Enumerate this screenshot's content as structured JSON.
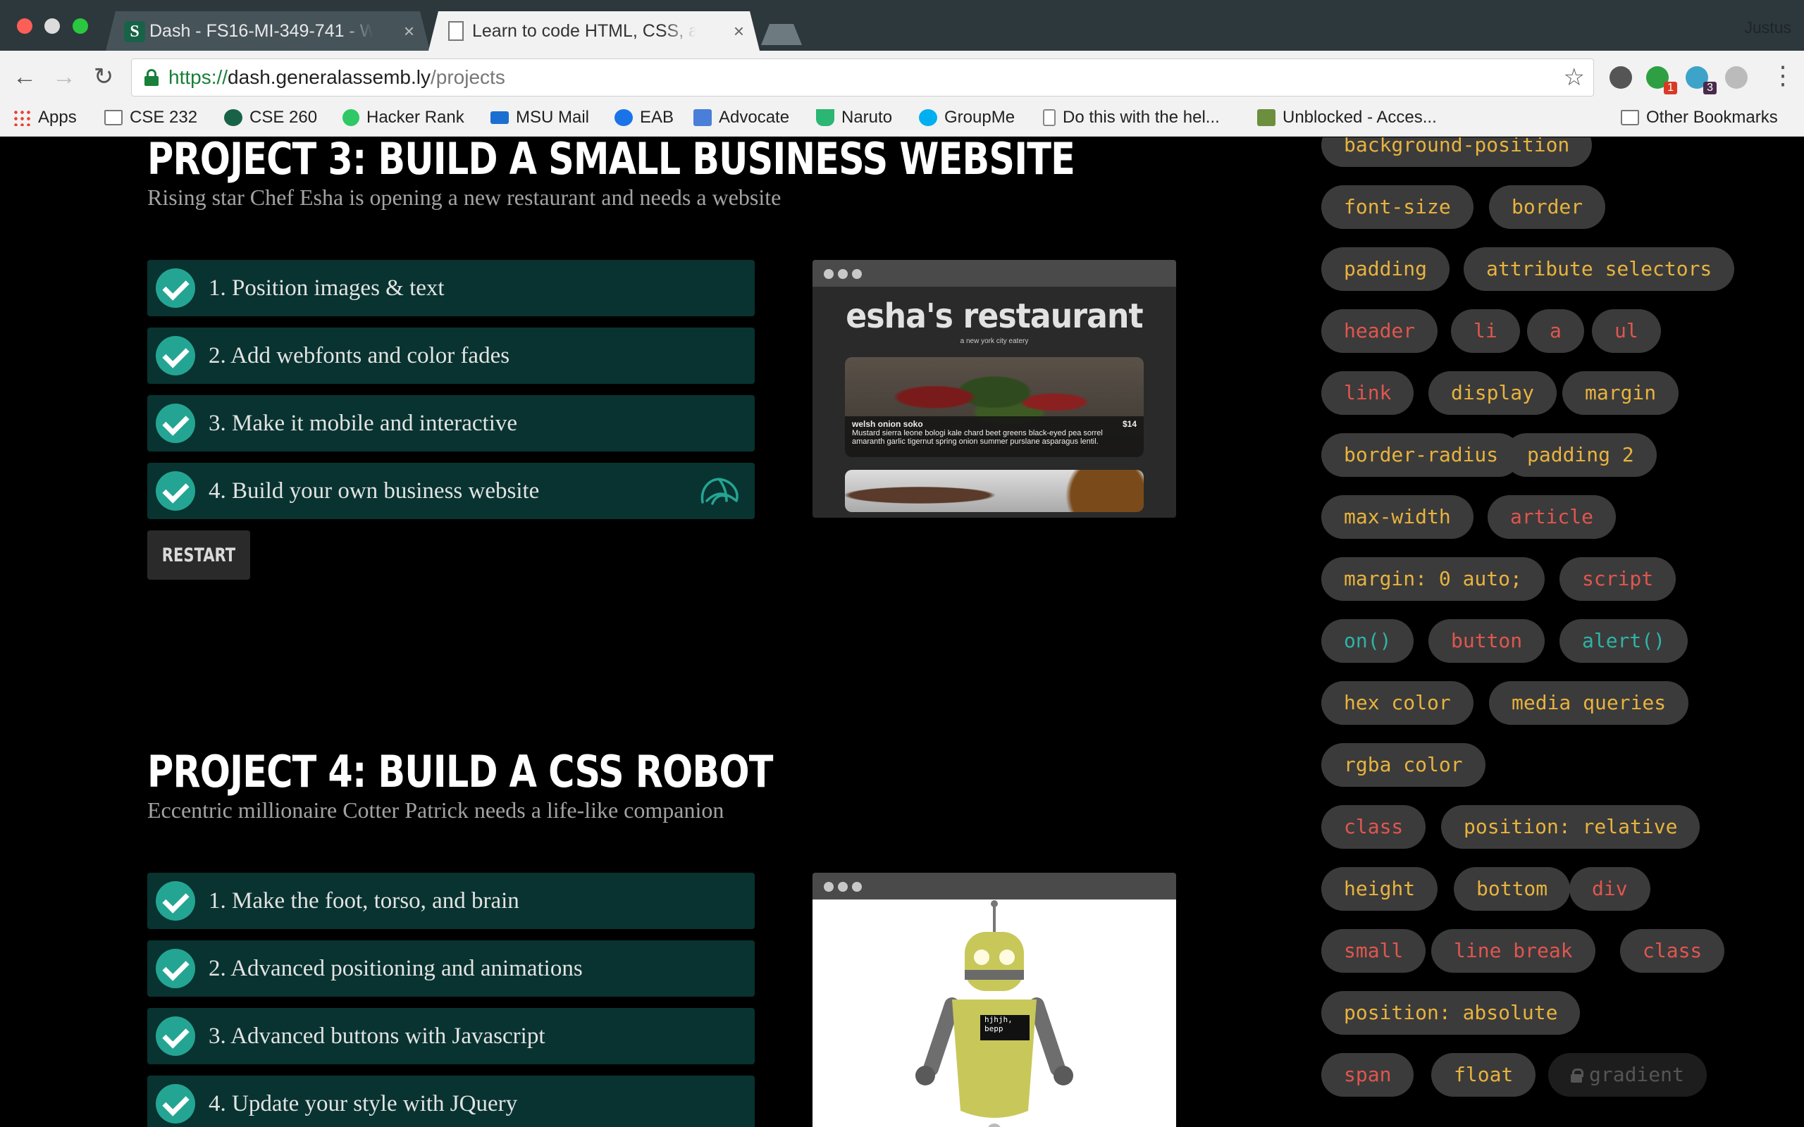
{
  "browser": {
    "tabs": [
      {
        "title": "Dash - FS16-MI-349-741 - W",
        "close": "×"
      },
      {
        "title": "Learn to code HTML, CSS, and",
        "close": "×"
      }
    ],
    "profile": "Justus",
    "url": {
      "scheme": "https://",
      "host": "dash.generalassemb.ly",
      "path": "/projects"
    },
    "extensions": [
      {
        "name": "w-icon",
        "badge": ""
      },
      {
        "name": "evernote-icon",
        "badge": "1"
      },
      {
        "name": "slack-icon",
        "badge": "3"
      },
      {
        "name": "www-icon",
        "badge": ""
      }
    ],
    "bookmarks": [
      {
        "label": "Apps",
        "icon": "apps-icon"
      },
      {
        "label": "CSE 232",
        "icon": "folder-icon"
      },
      {
        "label": "CSE 260",
        "icon": "spartan-icon"
      },
      {
        "label": "Hacker Rank",
        "icon": "hackerrank-icon"
      },
      {
        "label": "MSU Mail",
        "icon": "mail-icon"
      },
      {
        "label": "EAB",
        "icon": "eab-icon"
      },
      {
        "label": "Advocate",
        "icon": "advocate-icon"
      },
      {
        "label": "Naruto",
        "icon": "naruto-icon"
      },
      {
        "label": "GroupMe",
        "icon": "groupme-icon"
      },
      {
        "label": "Do this with the hel...",
        "icon": "document-icon"
      },
      {
        "label": "Unblocked - Acces...",
        "icon": "minecraft-icon"
      }
    ],
    "other_bookmarks": "Other Bookmarks"
  },
  "projects": [
    {
      "title": "Project 3: Build a small business website",
      "subtitle": "Rising star Chef Esha is opening a new restaurant and needs a website",
      "steps": [
        "1. Position images & text",
        "2. Add webfonts and color fades",
        "3. Make it mobile and interactive",
        "4. Build your own business website"
      ],
      "restart": "RESTART",
      "preview": {
        "title": "esha's restaurant",
        "tagline": "a new york city eatery",
        "dish": "welsh onion soko",
        "price": "$14",
        "desc": "Mustard sierra leone bologi kale chard beet greens black-eyed pea sorrel amaranth garlic tigernut spring onion summer purslane asparagus lentil."
      }
    },
    {
      "title": "Project 4: Build a CSS robot",
      "subtitle": "Eccentric millionaire Cotter Patrick needs a life-like companion",
      "steps": [
        "1. Make the foot, torso, and brain",
        "2. Advanced positioning and animations",
        "3. Advanced buttons with Javascript",
        "4. Update your style with JQuery"
      ],
      "robot_screen": "hjhjh, bepp"
    }
  ],
  "tags": [
    {
      "label": "background-position",
      "color": "yellow"
    },
    {
      "label": "font-size",
      "color": "yellow"
    },
    {
      "label": "border",
      "color": "yellow"
    },
    {
      "label": "padding",
      "color": "yellow"
    },
    {
      "label": "attribute selectors",
      "color": "yellow"
    },
    {
      "label": "header",
      "color": "red"
    },
    {
      "label": "li",
      "color": "red"
    },
    {
      "label": "a",
      "color": "red"
    },
    {
      "label": "ul",
      "color": "red"
    },
    {
      "label": "link",
      "color": "red"
    },
    {
      "label": "display",
      "color": "yellow"
    },
    {
      "label": "margin",
      "color": "yellow"
    },
    {
      "label": "border-radius",
      "color": "yellow"
    },
    {
      "label": "padding 2",
      "color": "yellow"
    },
    {
      "label": "max-width",
      "color": "yellow"
    },
    {
      "label": "article",
      "color": "red"
    },
    {
      "label": "margin: 0 auto;",
      "color": "yellow"
    },
    {
      "label": "script",
      "color": "red"
    },
    {
      "label": "on()",
      "color": "teal"
    },
    {
      "label": "button",
      "color": "red"
    },
    {
      "label": "alert()",
      "color": "teal"
    },
    {
      "label": "hex color",
      "color": "yellow"
    },
    {
      "label": "media queries",
      "color": "yellow"
    },
    {
      "label": "rgba color",
      "color": "yellow"
    },
    {
      "label": "class",
      "color": "red"
    },
    {
      "label": "position: relative",
      "color": "yellow"
    },
    {
      "label": "height",
      "color": "yellow"
    },
    {
      "label": "bottom",
      "color": "yellow"
    },
    {
      "label": "div",
      "color": "red"
    },
    {
      "label": "small",
      "color": "red"
    },
    {
      "label": "line break",
      "color": "red"
    },
    {
      "label": "class",
      "color": "red"
    },
    {
      "label": "position: absolute",
      "color": "yellow"
    },
    {
      "label": "span",
      "color": "red"
    },
    {
      "label": "float",
      "color": "yellow"
    },
    {
      "label": "gradient",
      "color": "locked"
    }
  ],
  "colors": {
    "yellow": "#e8b33e",
    "red": "#e0564f",
    "teal": "#2eb4a7",
    "step_bg": "#083330",
    "check": "#24a593"
  }
}
